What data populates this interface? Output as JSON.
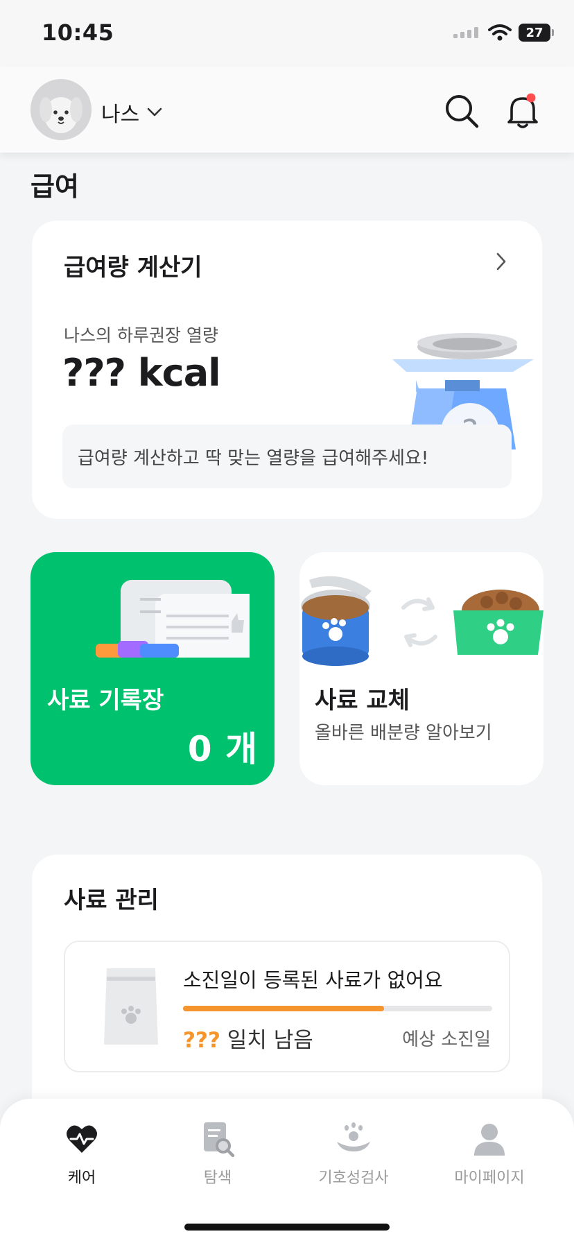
{
  "status_bar": {
    "time": "10:45",
    "battery": "27"
  },
  "header": {
    "pet_name": "나스"
  },
  "page": {
    "title": "급여"
  },
  "calculator": {
    "title": "급여량 계산기",
    "subtitle": "나스의 하루권장 열량",
    "kcal": "??? kcal",
    "banner": "급여량 계산하고 딱 맞는 열량을 급여해주세요!",
    "illustration_mark": "?"
  },
  "record_card": {
    "label": "사료 기록장",
    "count": "0 개"
  },
  "swap_card": {
    "title": "사료 교체",
    "subtitle": "올바른 배분량 알아보기"
  },
  "food_management": {
    "title": "사료 관리",
    "empty_message": "소진일이 등록된 사료가 없어요",
    "remaining_prefix": "???",
    "remaining_suffix": " 일치 남음",
    "due_label": "예상 소진일",
    "progress": 0.65
  },
  "tabs": [
    {
      "label": "케어",
      "icon": "heart-pulse-icon",
      "active": true
    },
    {
      "label": "탐색",
      "icon": "document-search-icon",
      "active": false
    },
    {
      "label": "기호성검사",
      "icon": "dog-bowl-icon",
      "active": false
    },
    {
      "label": "마이페이지",
      "icon": "person-icon",
      "active": false
    }
  ],
  "colors": {
    "accent_green": "#00c16d",
    "progress_orange": "#f5952e",
    "notification_dot": "#ff4d4f"
  }
}
